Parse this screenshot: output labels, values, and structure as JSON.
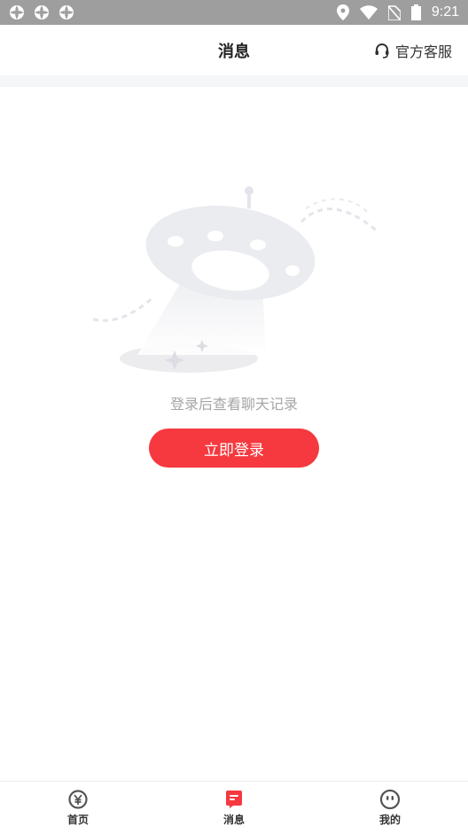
{
  "status_bar": {
    "time": "9:21",
    "icons": [
      "app-notification-icon",
      "app-notification-icon",
      "app-notification-icon",
      "location-icon",
      "wifi-icon",
      "no-sim-icon",
      "battery-icon"
    ]
  },
  "header": {
    "title": "消息",
    "service_label": "官方客服",
    "service_icon": "headset-icon"
  },
  "empty_state": {
    "illustration": "ufo-illustration",
    "message": "登录后查看聊天记录",
    "button_label": "立即登录"
  },
  "tabbar": {
    "items": [
      {
        "label": "首页",
        "icon": "yen-coin-icon"
      },
      {
        "label": "消息",
        "icon": "message-icon",
        "active": true
      },
      {
        "label": "我的",
        "icon": "profile-face-icon"
      }
    ]
  },
  "colors": {
    "accent": "#f5393f",
    "status_bar": "#9e9e9e",
    "muted_text": "#a6a6a6"
  }
}
